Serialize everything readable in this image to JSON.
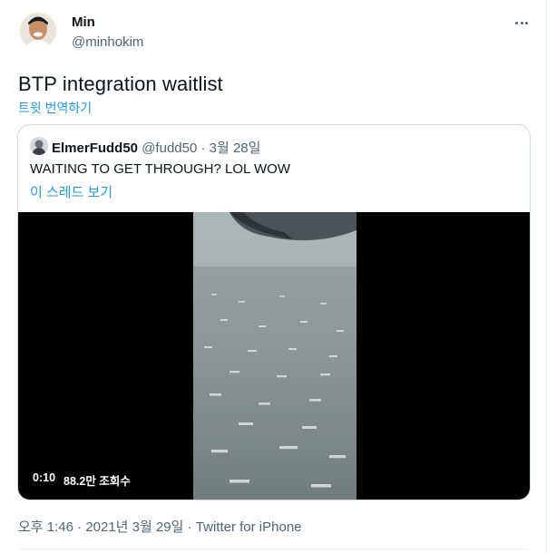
{
  "author": {
    "display_name": "Min",
    "handle": "@minhokim"
  },
  "tweet": {
    "text": "BTP integration waitlist",
    "translate_label": "트윗 번역하기"
  },
  "quoted_tweet": {
    "display_name": "ElmerFudd50",
    "handle": "@fudd50",
    "separator": " · ",
    "date": "3월 28일",
    "text": "WAITING TO GET THROUGH? LOL WOW",
    "show_thread_label": "이 스레드 보기",
    "video": {
      "time": "0:10",
      "views": "88.2만 조회수"
    }
  },
  "footer": {
    "time": "오후 1:46",
    "sep1": " · ",
    "date": "2021년 3월 29일",
    "sep2": " · ",
    "source": "Twitter for iPhone"
  },
  "icons": {
    "more": "more-horizontal-icon"
  },
  "colors": {
    "link": "#1d9bf0",
    "secondary_text": "#536471",
    "border": "#cfd9de"
  }
}
